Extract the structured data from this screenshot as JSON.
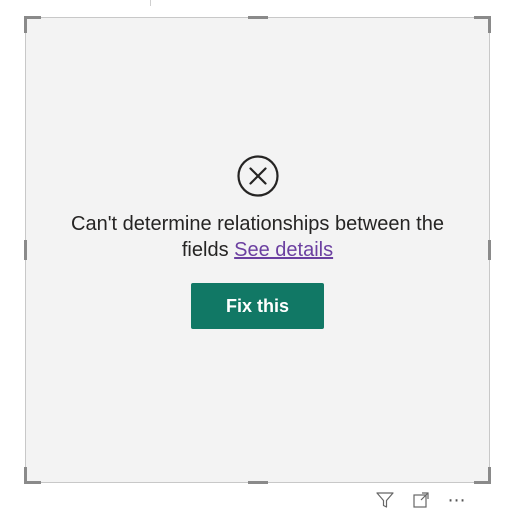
{
  "error": {
    "message_main": "Can't determine relationships between the fields",
    "link_label": "See details",
    "button_label": "Fix this",
    "icon": "circle-x-icon"
  },
  "visual_header": {
    "icons": [
      "filter-icon",
      "focus-mode-icon",
      "more-options-icon"
    ],
    "more_label": "⋯"
  },
  "colors": {
    "button_bg": "#117865",
    "link": "#6b3fa0",
    "visual_bg": "#f3f3f3"
  }
}
